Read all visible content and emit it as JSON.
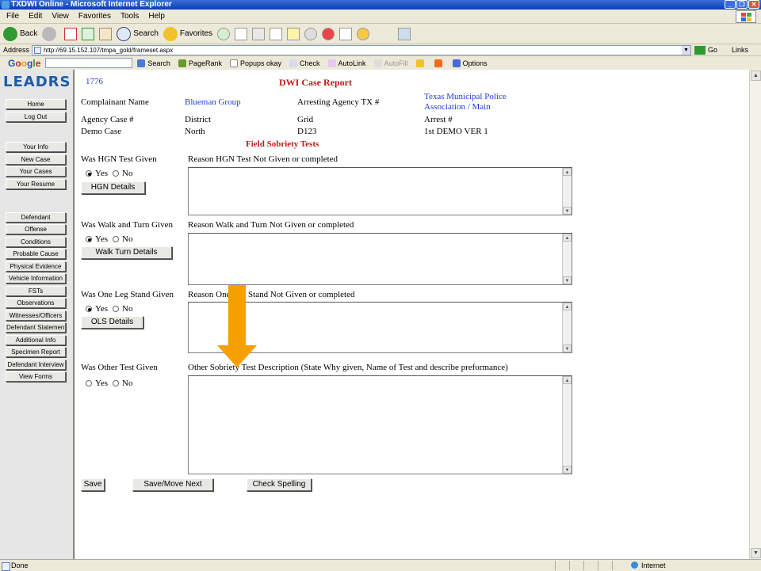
{
  "window": {
    "title": "TXDWI Online - Microsoft Internet Explorer"
  },
  "menu": [
    "File",
    "Edit",
    "View",
    "Favorites",
    "Tools",
    "Help"
  ],
  "toolbar": {
    "back": "Back",
    "search": "Search",
    "favorites": "Favorites"
  },
  "address": {
    "label": "Address",
    "url": "http://69.15.152.107/tmpa_gold/frameset.aspx",
    "go": "Go",
    "links": "Links"
  },
  "google_toolbar": {
    "logo": [
      "G",
      "o",
      "o",
      "g",
      "l",
      "e"
    ],
    "search": "Search",
    "pagerank": "PageRank",
    "popups": "Popups okay",
    "check": "Check",
    "autolink": "AutoLink",
    "autofill": "AutoFill",
    "options": "Options"
  },
  "nav": {
    "logo": "LEADRS",
    "buttons": [
      "Home",
      "Log Out",
      "Your Info",
      "New Case",
      "Your Cases",
      "Your Resume",
      "Defendant",
      "Offense",
      "Conditions",
      "Probable Cause",
      "Physical Evidence",
      "Vehicle Information",
      "FSTs",
      "Observations",
      "Witnesses/Officers",
      "Defendant Statement",
      "Additional Info",
      "Specimen Report",
      "Defendant Interview",
      "View Forms"
    ]
  },
  "report": {
    "case_number": "1776",
    "title": "DWI Case Report",
    "complainant_label": "Complainant Name",
    "complainant_value": "Blueman Group",
    "arresting_agency_label": "Arresting Agency TX #",
    "arresting_agency_value_line1": "Texas Municipal Police",
    "arresting_agency_value_line2": "Association / Main",
    "agency_case_label": "Agency Case #",
    "district_label": "District",
    "grid_label": "Grid",
    "arrest_label": "Arrest #",
    "agency_case_value": "Demo Case",
    "district_value": "North",
    "grid_value": "D123",
    "arrest_value": "1st DEMO VER 1",
    "section_title": "Field Sobriety Tests"
  },
  "tests": {
    "hgn": {
      "question": "Was HGN Test Given",
      "reason_label": "Reason HGN Test Not Given or completed",
      "yes": "Yes",
      "no": "No",
      "selected": "Yes",
      "details_button": "HGN Details"
    },
    "walk_turn": {
      "question": "Was Walk and Turn Given",
      "reason_label": "Reason Walk and Turn Not Given or completed",
      "yes": "Yes",
      "no": "No",
      "selected": "Yes",
      "details_button": "Walk Turn Details"
    },
    "one_leg": {
      "question": "Was One Leg Stand Given",
      "reason_label": "Reason One Leg Stand Not Given or completed",
      "yes": "Yes",
      "no": "No",
      "selected": "Yes",
      "details_button": "OLS Details"
    },
    "other": {
      "question": "Was Other Test Given",
      "reason_label": "Other Sobriety Test Description (State Why given, Name of Test and describe preformance)",
      "yes": "Yes",
      "no": "No",
      "selected": "none"
    }
  },
  "actions": {
    "save": "Save",
    "save_move_next": "Save/Move Next",
    "check_spelling": "Check Spelling"
  },
  "status": {
    "text": "Done",
    "zone": "Internet"
  },
  "colors": {
    "link_blue": "#1f3ad8",
    "heading_red": "#c01818",
    "arrow_orange": "#f5a000",
    "logo_blue": "#1f5ca8"
  }
}
